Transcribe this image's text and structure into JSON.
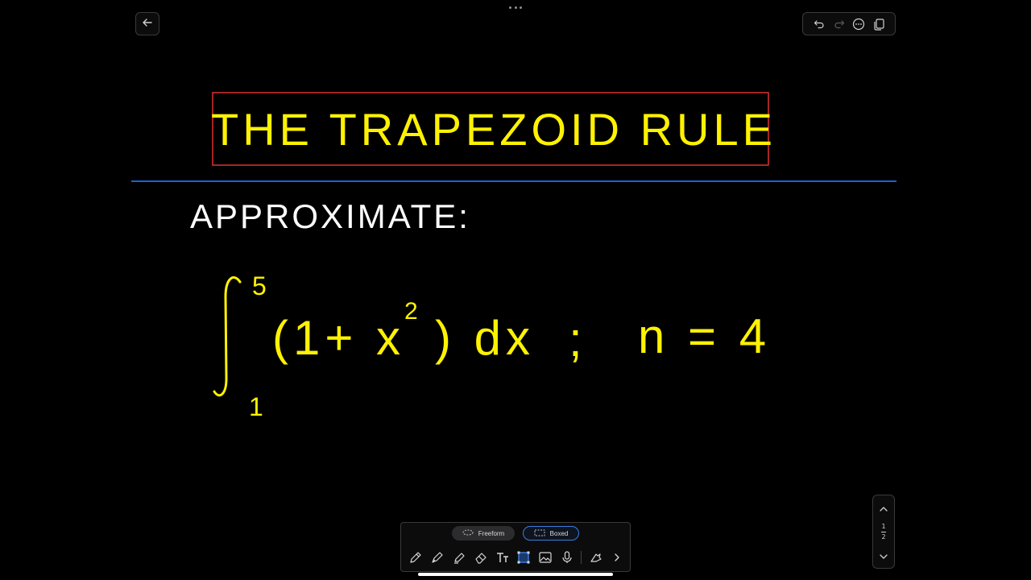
{
  "board": {
    "title": "THE TRAPEZOID RULE",
    "instruction": "APPROXIMATE:",
    "integral": {
      "lower_limit": "1",
      "upper_limit": "5",
      "integrand": "(1+ x",
      "exponent": "2",
      "closing": ") dx",
      "separator": ";",
      "condition": "n = 4"
    },
    "colors": {
      "ink_yellow": "#fff200",
      "ink_white": "#ffffff",
      "title_box": "#e03030",
      "divider_line": "#1f5fd6"
    }
  },
  "toolbar_top": {
    "icons": [
      "undo-icon",
      "redo-icon",
      "more-icon",
      "duplicate-page-icon"
    ]
  },
  "pager": {
    "current_page": "1",
    "total_pages": "2"
  },
  "bottom_toolbar": {
    "modes": {
      "freeform_label": "Freeform",
      "boxed_label": "Boxed",
      "selected": "Boxed"
    },
    "tools": [
      "pen-icon",
      "fountain-pen-icon",
      "highlighter-icon",
      "eraser-icon",
      "text-icon",
      "box-select-icon",
      "image-icon",
      "microphone-icon",
      "lasso-icon",
      "chevron-right-icon"
    ]
  }
}
